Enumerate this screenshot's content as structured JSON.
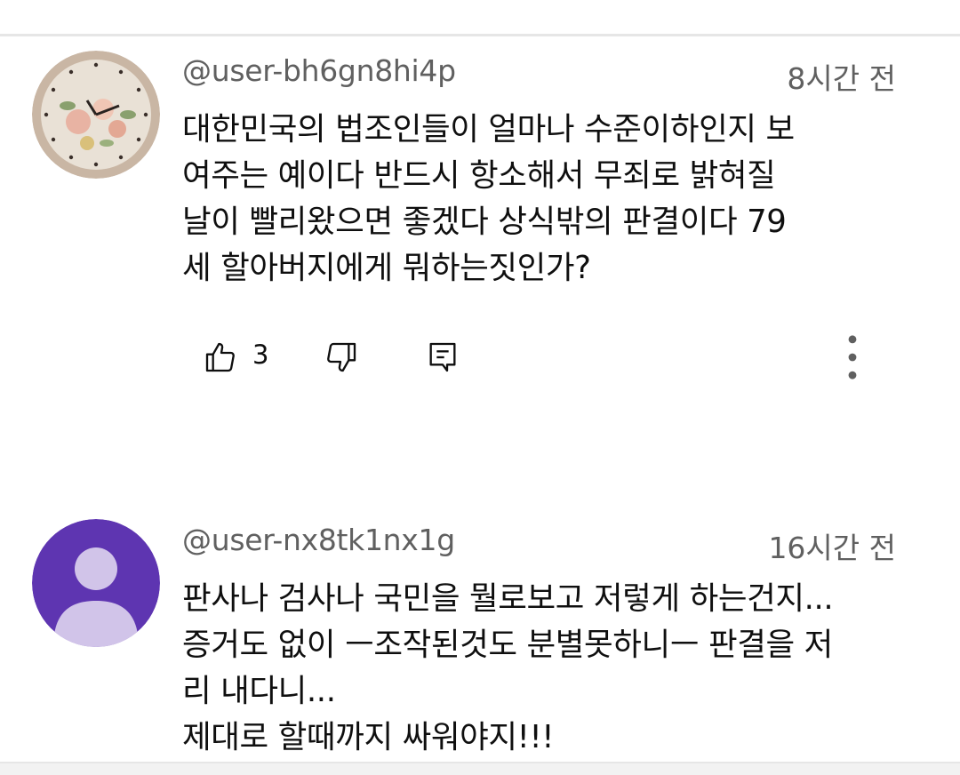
{
  "comments": [
    {
      "username": "@user-bh6gn8hi4p",
      "timestamp": "8시간 전",
      "text": "대한민국의 법조인들이 얼마나  수준이하인지  보\n여주는 예이다   반드시 항소해서  무죄로  밝혀질\n날이   빨리왔으면 좋겠다  상식밖의 판결이다  79\n세 할아버지에게 뭐하는짓인가?",
      "like_count": "3",
      "avatar": "floral-clock-photo"
    },
    {
      "username": "@user-nx8tk1nx1g",
      "timestamp": "16시간 전",
      "text": "판사나 검사나 국민을 뭘로보고 저렇게 하는건지...\n증거도 없이 ㅡ조작된것도 분별못하니ㅡ 판결을 저\n리 내다니...\n제대로 할때까지 싸워야지!!!",
      "avatar": "default-person-avatar"
    }
  ],
  "icons": {
    "like": "thumbs-up-icon",
    "dislike": "thumbs-down-icon",
    "reply": "reply-icon",
    "more": "more-vertical-icon"
  },
  "colors": {
    "avatar_purple": "#5e35b1",
    "avatar_person": "#d1c4e9",
    "secondary_text": "#606060"
  }
}
